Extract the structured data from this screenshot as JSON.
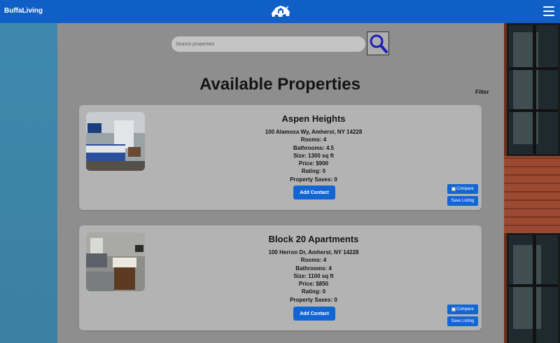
{
  "header": {
    "brand": "BuffaLiving",
    "logo_icon": "buffalo-house-logo",
    "menu_icon": "hamburger-menu-icon",
    "bar_color": "#0f5fc7"
  },
  "search": {
    "placeholder": "Search properties",
    "value": "",
    "button_icon": "magnifier-icon"
  },
  "page_title": "Available Properties",
  "filter_label": "Filter",
  "listings": [
    {
      "name": "Aspen Heights",
      "address": "100 Alamosa Wy, Amherst, NY 14228",
      "rooms": "Rooms: 4",
      "bathrooms": "Bathrooms: 4.5",
      "size": "Size: 1300 sq ft",
      "price": "Price: $900",
      "rating": "Rating: 0",
      "saves": "Property Saves: 0",
      "contact_label": "Add Contact",
      "compare_label": "Compare",
      "save_label": "Save Listing"
    },
    {
      "name": "Block 20 Apartments",
      "address": "100 Herron Dr, Amherst, NY 14228",
      "rooms": "Rooms: 4",
      "bathrooms": "Bathrooms: 4",
      "size": "Size: 1100 sq ft",
      "price": "Price: $850",
      "rating": "Rating: 0",
      "saves": "Property Saves: 0",
      "contact_label": "Add Contact",
      "compare_label": "Compare",
      "save_label": "Save Listing"
    }
  ],
  "colors": {
    "accent": "#1266d4",
    "panel": "#8e8e8e",
    "card": "#b3b3b3"
  }
}
